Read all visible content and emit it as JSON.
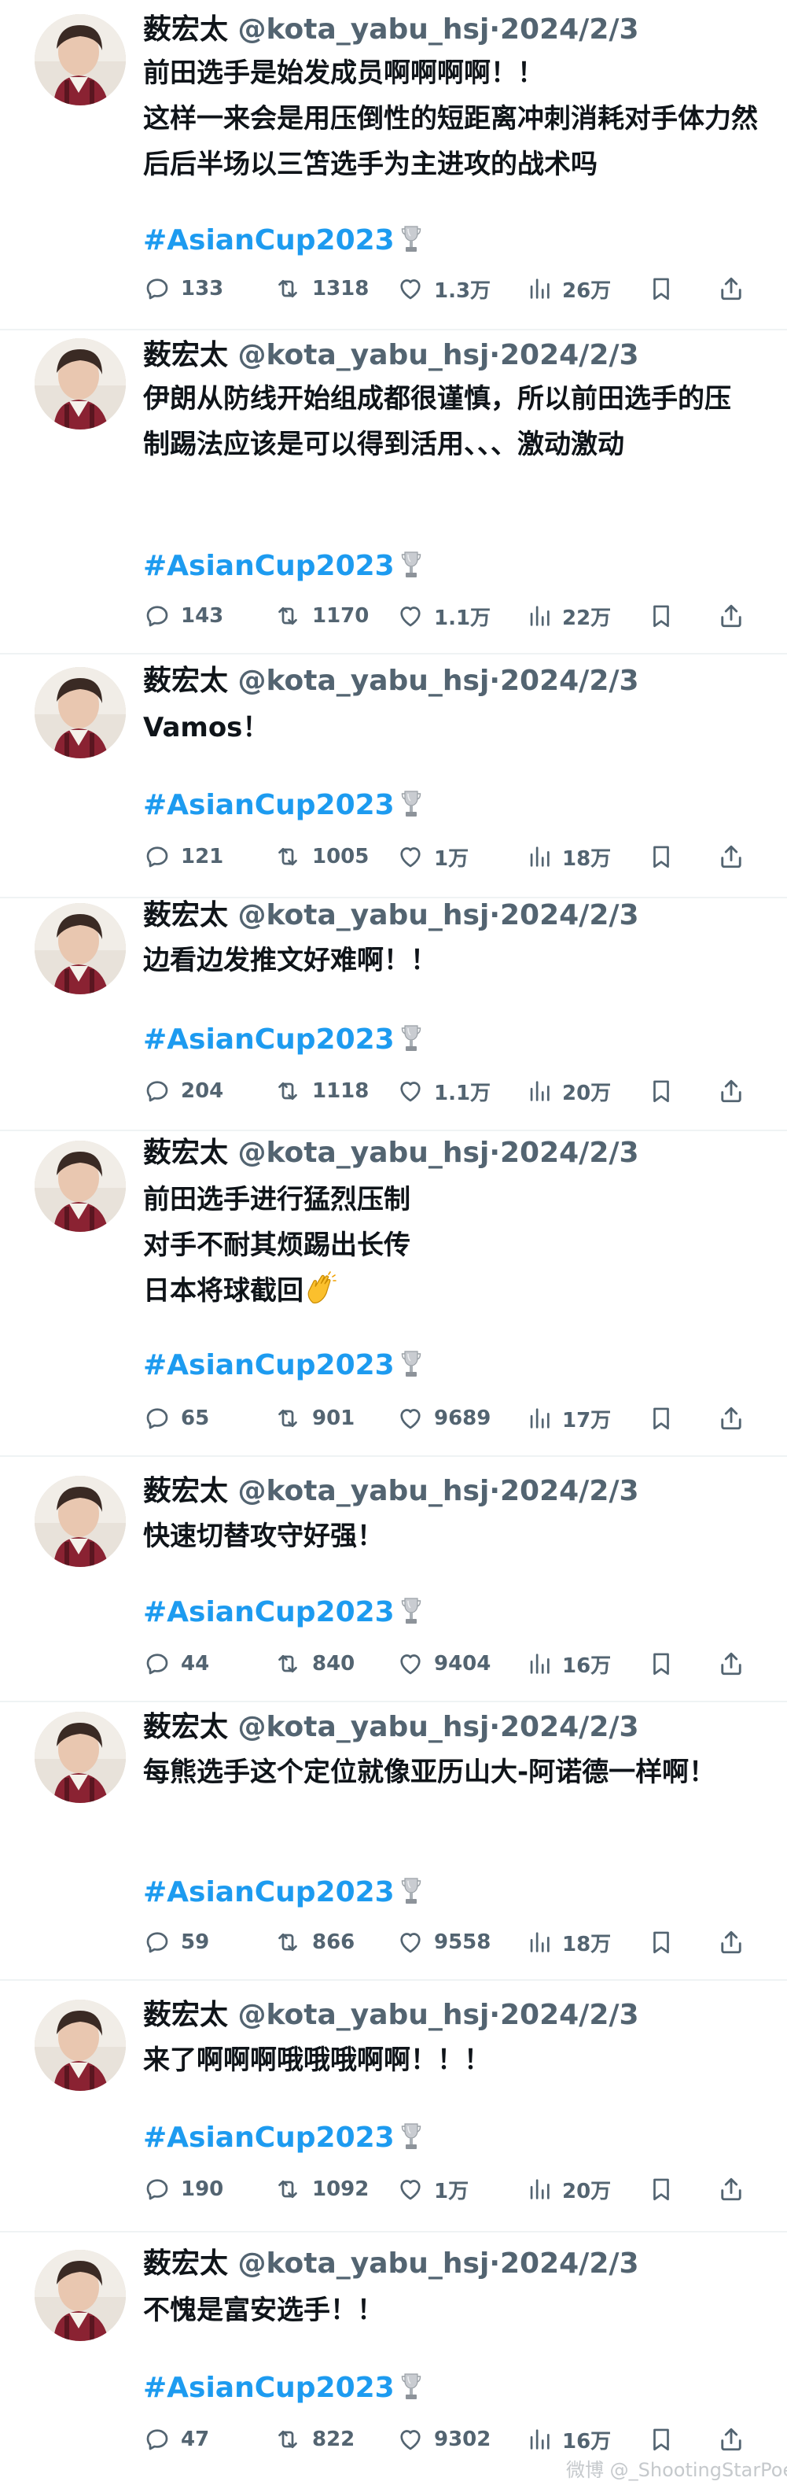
{
  "author": {
    "name": "薮宏太",
    "handle": "@kota_yabu_hsj",
    "date": "·2024/2/3"
  },
  "hashtag": "#AsianCup2023",
  "colors": {
    "hashtag": "#1d9bf0",
    "secondary_text": "#536471",
    "separator": "#eff3f4"
  },
  "icons": {
    "reply": "speech-bubble-icon",
    "retweet": "retweet-arrows-icon",
    "like": "heart-icon",
    "views": "bar-chart-icon",
    "bookmark": "bookmark-icon",
    "share": "share-upload-icon",
    "more": "more-dots-icon",
    "trophy": "trophy-emoji",
    "clap": "clapping-hands-emoji"
  },
  "tweets": [
    {
      "text": "前田选手是始发成员啊啊啊啊！！\n这样一来会是用压倒性的短距离冲刺消耗对手体力然后后半场以三笘选手为主进攻的战术吗",
      "replies": "133",
      "retweets": "1318",
      "likes": "1.3万",
      "views": "26万"
    },
    {
      "text": "伊朗从防线开始组成都很谨慎，所以前田选手的压制踢法应该是可以得到活用、、、激动激动",
      "replies": "143",
      "retweets": "1170",
      "likes": "1.1万",
      "views": "22万"
    },
    {
      "text": "Vamos！",
      "replies": "121",
      "retweets": "1005",
      "likes": "1万",
      "views": "18万"
    },
    {
      "text": "边看边发推文好难啊！！",
      "replies": "204",
      "retweets": "1118",
      "likes": "1.1万",
      "views": "20万"
    },
    {
      "text": "前田选手进行猛烈压制\n对手不耐其烦踢出长传\n日本将球截回",
      "replies": "65",
      "retweets": "901",
      "likes": "9689",
      "views": "17万"
    },
    {
      "text": "快速切替攻守好强！",
      "replies": "44",
      "retweets": "840",
      "likes": "9404",
      "views": "16万"
    },
    {
      "text": "每熊选手这个定位就像亚历山大-阿诺德一样啊！",
      "replies": "59",
      "retweets": "866",
      "likes": "9558",
      "views": "18万"
    },
    {
      "text": "来了啊啊啊哦哦哦啊啊！！！",
      "replies": "190",
      "retweets": "1092",
      "likes": "1万",
      "views": "20万"
    },
    {
      "text": "不愧是富安选手！！",
      "replies": "47",
      "retweets": "822",
      "likes": "9302",
      "views": "16万"
    }
  ],
  "watermark": "微博 @_ShootingStarPoet_"
}
